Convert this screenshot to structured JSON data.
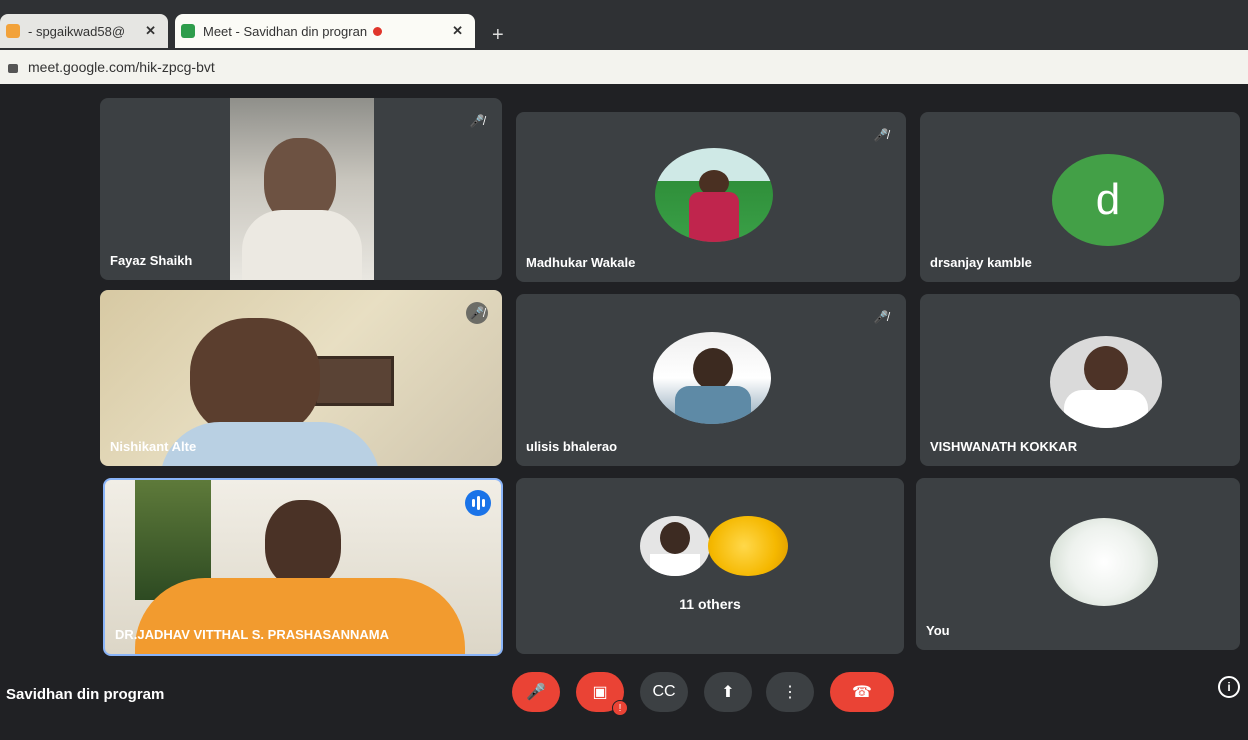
{
  "browser": {
    "tabs": [
      {
        "label": "- spgaikwad58@"
      },
      {
        "label": "Meet - Savidhan din progran"
      }
    ],
    "new_tab": "+",
    "url": "meet.google.com/hik-zpcg-bvt"
  },
  "participants": [
    {
      "name": "Fayaz Shaikh"
    },
    {
      "name": "Madhukar Wakale"
    },
    {
      "name": "drsanjay kamble",
      "initial": "d"
    },
    {
      "name": "Nishikant Alte"
    },
    {
      "name": "ulisis bhalerao"
    },
    {
      "name": "VISHWANATH KOKKAR"
    },
    {
      "name": "DR.JADHAV VITTHAL S. PRASHASANNAMA"
    },
    {
      "name": "11 others"
    },
    {
      "name": "You"
    }
  ],
  "meeting": {
    "title": "Savidhan din program"
  },
  "icons": {
    "mic_off": "mic-off-icon",
    "cam_off": "camera-off-icon",
    "captions": "captions-icon",
    "present": "present-screen-icon",
    "more": "more-vert-icon",
    "end": "end-call-icon",
    "info": "info-icon",
    "close": "close-icon"
  },
  "colors": {
    "end_call": "#ea4335",
    "speaker": "#1a73e8",
    "avatar_d": "#43a047"
  }
}
